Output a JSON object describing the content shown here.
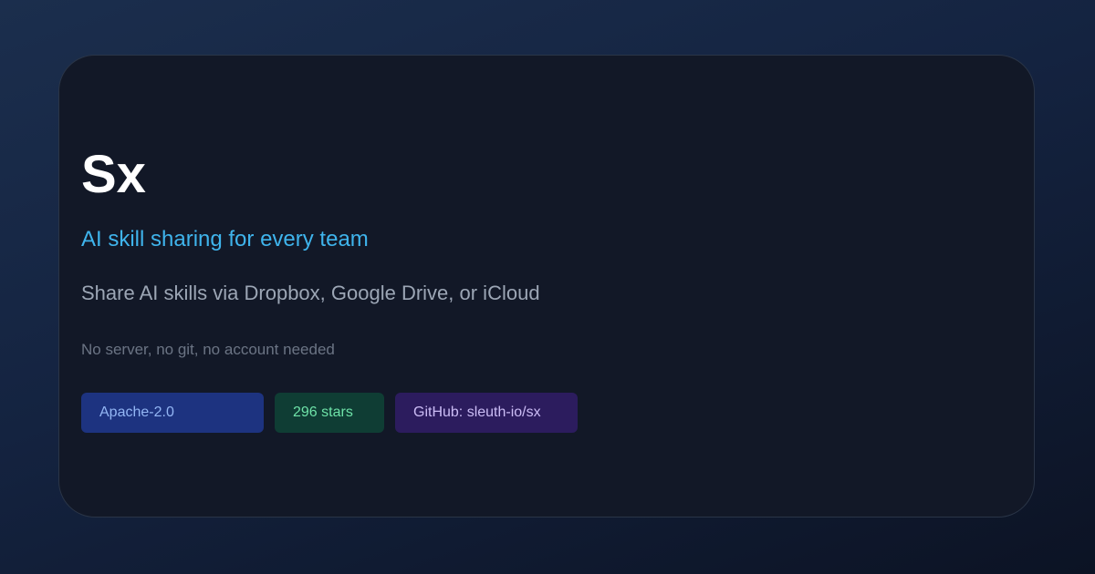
{
  "card": {
    "title": "Sx",
    "tagline": "AI skill sharing for every team",
    "description": "Share AI skills via Dropbox, Google Drive, or iCloud",
    "note": "No server, no git, no account needed"
  },
  "badges": {
    "license": "Apache-2.0",
    "stars": "296 stars",
    "github": "GitHub: sleuth-io/sx"
  },
  "colors": {
    "card_background": "#121827",
    "title": "#ffffff",
    "tagline": "#3fb4ec",
    "license_badge": "#1d3380",
    "stars_badge": "#0f3d34",
    "github_badge": "#2c1c5e"
  }
}
